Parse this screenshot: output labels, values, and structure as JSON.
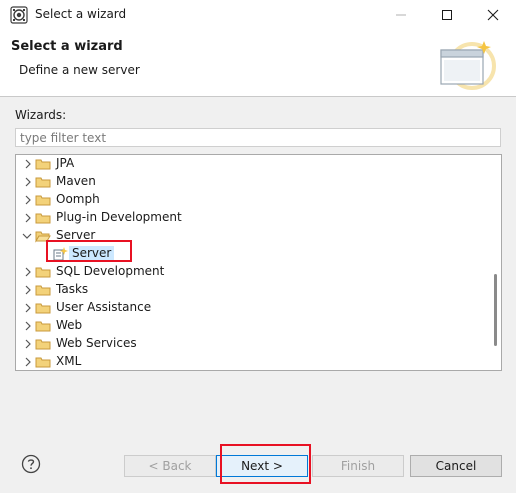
{
  "window": {
    "title": "Select a wizard",
    "icon": "eclipse-icon",
    "controls": [
      "minimize-icon",
      "maximize-icon",
      "close-icon"
    ]
  },
  "header": {
    "title": "Select a wizard",
    "description": "Define a new server",
    "banner_icon": "new-wizard-icon"
  },
  "filter": {
    "label": "Wizards:",
    "placeholder": "type filter text",
    "value": ""
  },
  "tree": {
    "items": [
      {
        "label": "JPA",
        "expanded": false,
        "level": 0,
        "icon": "folder-icon"
      },
      {
        "label": "Maven",
        "expanded": false,
        "level": 0,
        "icon": "folder-icon"
      },
      {
        "label": "Oomph",
        "expanded": false,
        "level": 0,
        "icon": "folder-icon"
      },
      {
        "label": "Plug-in Development",
        "expanded": false,
        "level": 0,
        "icon": "folder-icon"
      },
      {
        "label": "Server",
        "expanded": true,
        "level": 0,
        "icon": "folder-icon"
      },
      {
        "label": "Server",
        "expanded": null,
        "level": 1,
        "icon": "server-wizard-icon",
        "selected": true
      },
      {
        "label": "SQL Development",
        "expanded": false,
        "level": 0,
        "icon": "folder-icon"
      },
      {
        "label": "Tasks",
        "expanded": false,
        "level": 0,
        "icon": "folder-icon"
      },
      {
        "label": "User Assistance",
        "expanded": false,
        "level": 0,
        "icon": "folder-icon"
      },
      {
        "label": "Web",
        "expanded": false,
        "level": 0,
        "icon": "folder-icon"
      },
      {
        "label": "Web Services",
        "expanded": false,
        "level": 0,
        "icon": "folder-icon"
      },
      {
        "label": "XML",
        "expanded": false,
        "level": 0,
        "icon": "folder-icon"
      }
    ]
  },
  "buttons": {
    "back": "< Back",
    "next": "Next >",
    "finish": "Finish",
    "cancel": "Cancel",
    "help_icon": "help-icon"
  },
  "colors": {
    "selection": "#cce8ff",
    "highlight_annotation": "#e81123",
    "folder": "#dcb35c",
    "default_button_border": "#0078d7"
  }
}
